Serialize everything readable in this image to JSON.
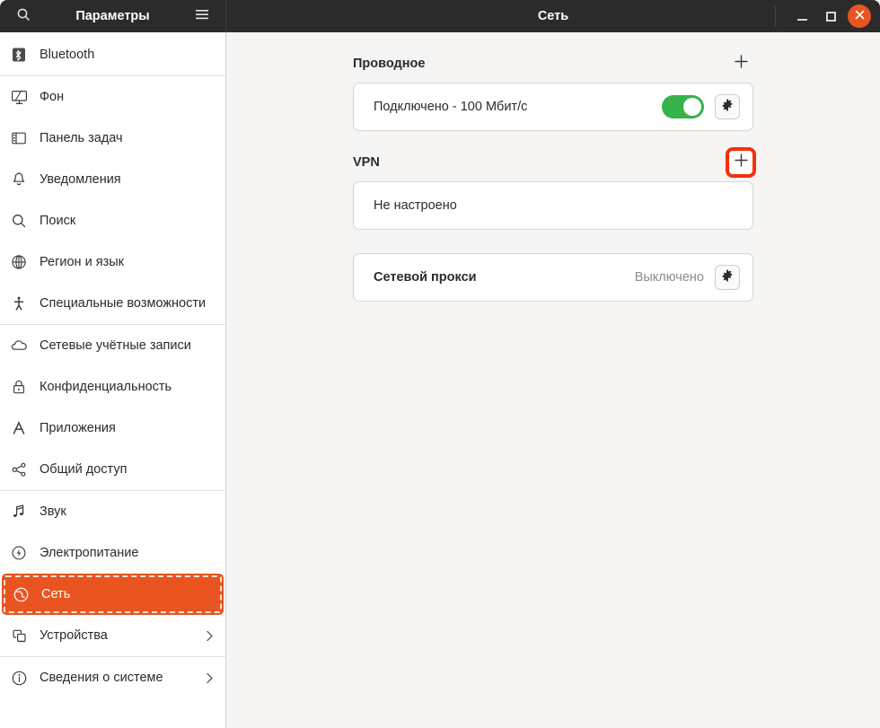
{
  "titlebar": {
    "sidebar_title": "Параметры",
    "main_title": "Сеть",
    "search_icon": "search-icon",
    "menu_icon": "hamburger-menu-icon",
    "minimize_label": "—",
    "maximize_label": "□",
    "close_label": "×",
    "bg_color": "#2b2b2b",
    "close_color": "#e95420"
  },
  "sidebar": {
    "accent_color": "#e95420",
    "items": [
      {
        "label": "Bluetooth",
        "icon": "bluetooth-icon",
        "selected": false,
        "chevron": false,
        "sep_after": true
      },
      {
        "label": "Фон",
        "icon": "background-icon",
        "selected": false,
        "chevron": false,
        "sep_after": false
      },
      {
        "label": "Панель задач",
        "icon": "dock-panel-icon",
        "selected": false,
        "chevron": false,
        "sep_after": false
      },
      {
        "label": "Уведомления",
        "icon": "bell-icon",
        "selected": false,
        "chevron": false,
        "sep_after": false
      },
      {
        "label": "Поиск",
        "icon": "search-icon",
        "selected": false,
        "chevron": false,
        "sep_after": false
      },
      {
        "label": "Регион и язык",
        "icon": "globe-grid-icon",
        "selected": false,
        "chevron": false,
        "sep_after": false
      },
      {
        "label": "Специальные возможности",
        "icon": "accessibility-icon",
        "selected": false,
        "chevron": false,
        "sep_after": true
      },
      {
        "label": "Сетевые учётные записи",
        "icon": "cloud-icon",
        "selected": false,
        "chevron": false,
        "sep_after": false
      },
      {
        "label": "Конфиденциальность",
        "icon": "lock-icon",
        "selected": false,
        "chevron": false,
        "sep_after": false
      },
      {
        "label": "Приложения",
        "icon": "font-a-icon",
        "selected": false,
        "chevron": false,
        "sep_after": false
      },
      {
        "label": "Общий доступ",
        "icon": "share-nodes-icon",
        "selected": false,
        "chevron": false,
        "sep_after": true
      },
      {
        "label": "Звук",
        "icon": "music-note-icon",
        "selected": false,
        "chevron": false,
        "sep_after": false
      },
      {
        "label": "Электропитание",
        "icon": "power-bolt-icon",
        "selected": false,
        "chevron": false,
        "sep_after": false
      },
      {
        "label": "Сеть",
        "icon": "network-globe-icon",
        "selected": true,
        "chevron": false,
        "sep_after": false
      },
      {
        "label": "Устройства",
        "icon": "devices-icon",
        "selected": false,
        "chevron": true,
        "sep_after": true
      },
      {
        "label": "Сведения о системе",
        "icon": "info-circle-icon",
        "selected": false,
        "chevron": true,
        "sep_after": false
      }
    ]
  },
  "main": {
    "wired": {
      "section_title": "Проводное",
      "add_icon": "plus-icon",
      "status": "Подключено - 100 Мбит/с",
      "toggle_on": true,
      "toggle_color": "#36b34a",
      "settings_icon": "gear-icon"
    },
    "vpn": {
      "section_title": "VPN",
      "add_icon": "plus-icon",
      "add_highlighted": true,
      "highlight_color": "#f4300a",
      "status": "Не настроено"
    },
    "proxy": {
      "label": "Сетевой прокси",
      "value": "Выключено",
      "settings_icon": "gear-icon"
    }
  }
}
